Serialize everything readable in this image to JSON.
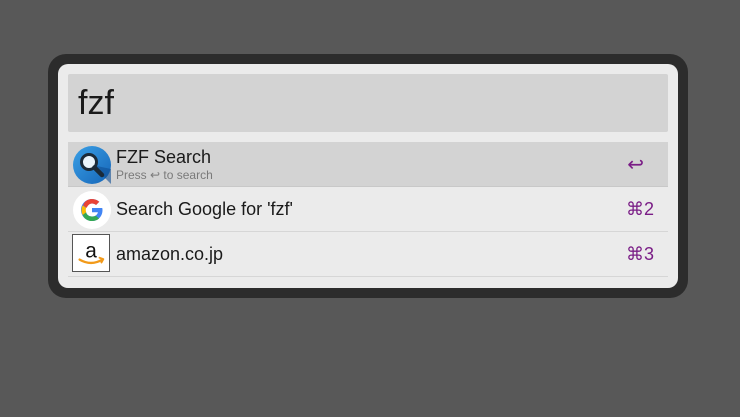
{
  "search": {
    "query": "fzf"
  },
  "results": [
    {
      "title": "FZF Search",
      "subtitle": "Press ↩ to search",
      "shortcut": "↩",
      "icon": "magnifier-icon"
    },
    {
      "title": "Search Google for 'fzf'",
      "shortcut": "⌘2",
      "icon": "google-g-icon"
    },
    {
      "title": "amazon.co.jp",
      "shortcut": "⌘3",
      "icon": "amazon-logo-icon"
    }
  ],
  "colors": {
    "shortcut": "#7a1d86",
    "selected_row": "#d3d3d3",
    "panel": "#ebebeb",
    "frame": "#2c2c2c",
    "desktop": "#585858"
  }
}
